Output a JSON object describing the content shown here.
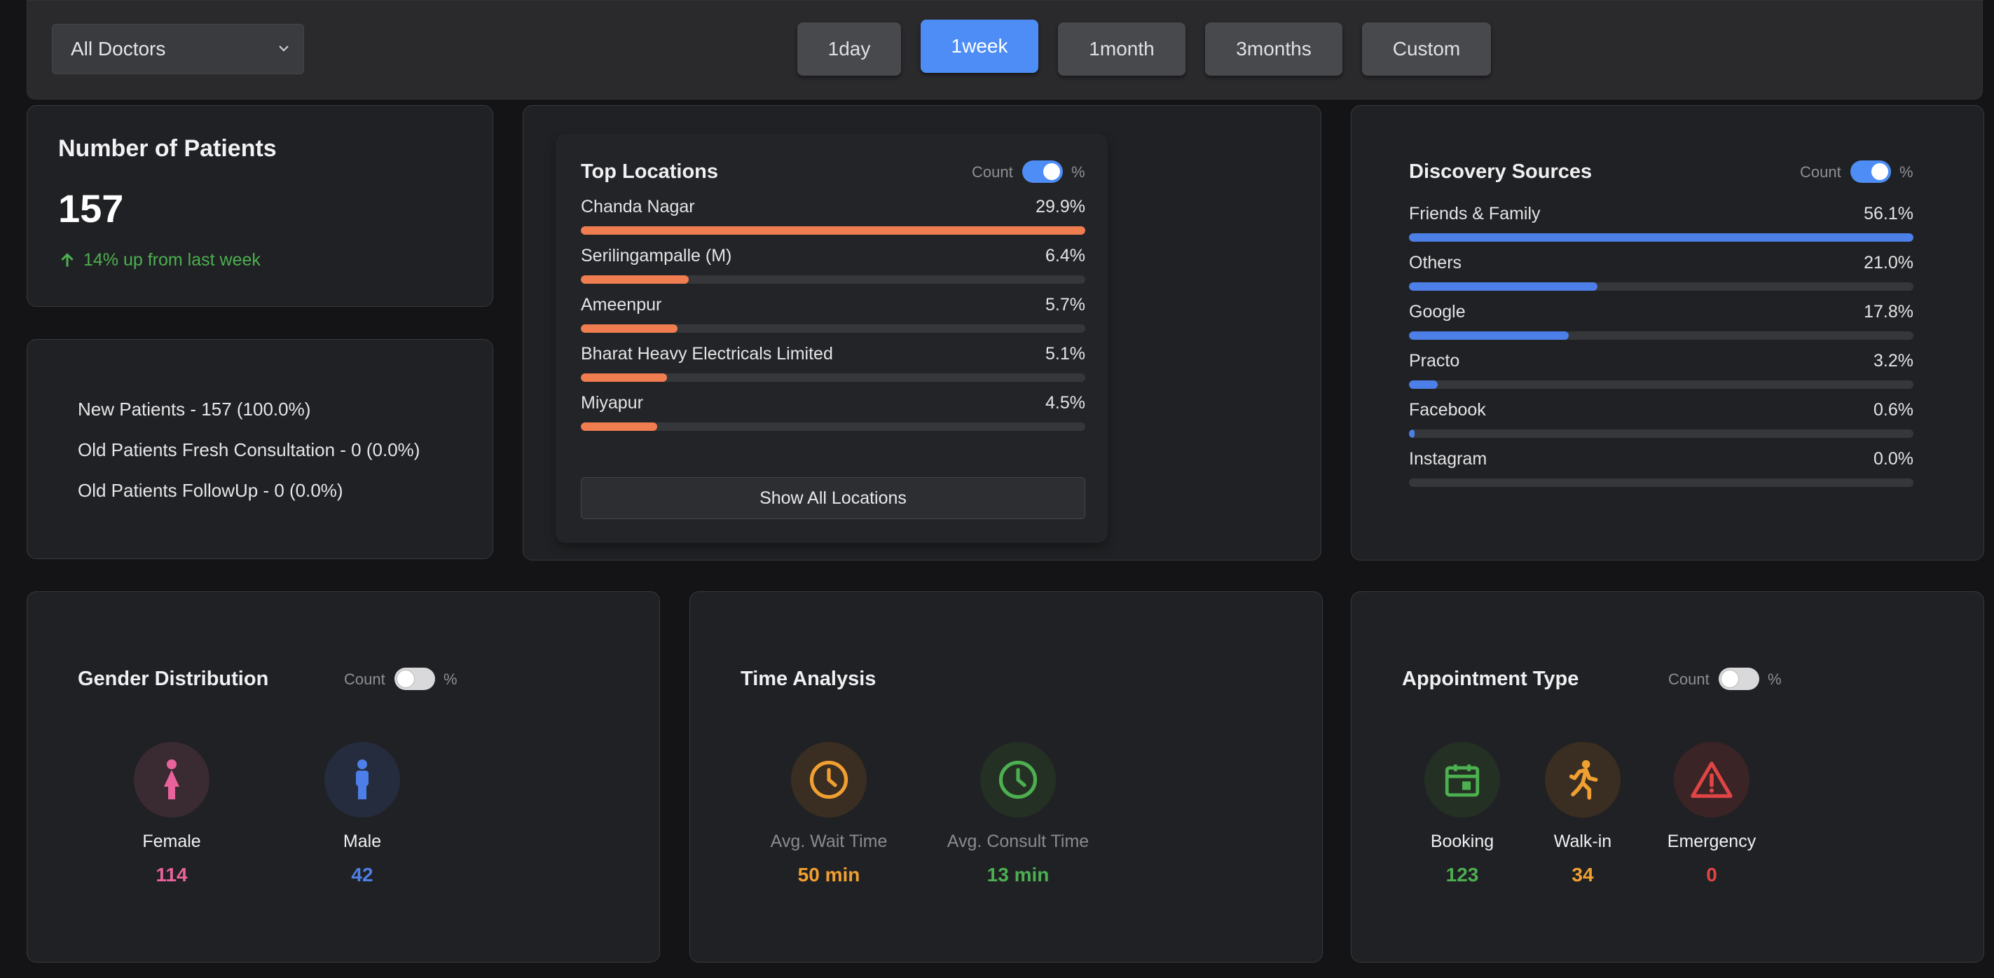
{
  "toolbar": {
    "doctor_select": "All Doctors",
    "ranges": [
      "1day",
      "1week",
      "1month",
      "3months",
      "Custom"
    ],
    "active_range": "1week"
  },
  "patients": {
    "title": "Number of Patients",
    "count": "157",
    "trend": "14% up from last week",
    "breakdown": [
      "New Patients - 157 (100.0%)",
      "Old Patients Fresh Consultation - 0 (0.0%)",
      "Old Patients FollowUp - 0 (0.0%)"
    ]
  },
  "locations": {
    "title": "Top Locations",
    "toggle_left": "Count",
    "toggle_right": "%",
    "toggle_on": true,
    "bar_color": "#f07d4f",
    "items": [
      {
        "label": "Chanda Nagar",
        "pct": "29.9%",
        "fill": 1.0
      },
      {
        "label": "Serilingampalle (M)",
        "pct": "6.4%",
        "fill": 0.214
      },
      {
        "label": "Ameenpur",
        "pct": "5.7%",
        "fill": 0.191
      },
      {
        "label": "Bharat Heavy Electricals Limited",
        "pct": "5.1%",
        "fill": 0.171
      },
      {
        "label": "Miyapur",
        "pct": "4.5%",
        "fill": 0.151
      }
    ],
    "show_all": "Show All Locations"
  },
  "discovery": {
    "title": "Discovery Sources",
    "toggle_left": "Count",
    "toggle_right": "%",
    "toggle_on": true,
    "bar_color": "#4d7fe8",
    "items": [
      {
        "label": "Friends & Family",
        "pct": "56.1%",
        "fill": 1.0
      },
      {
        "label": "Others",
        "pct": "21.0%",
        "fill": 0.374
      },
      {
        "label": "Google",
        "pct": "17.8%",
        "fill": 0.317
      },
      {
        "label": "Practo",
        "pct": "3.2%",
        "fill": 0.057
      },
      {
        "label": "Facebook",
        "pct": "0.6%",
        "fill": 0.011
      },
      {
        "label": "Instagram",
        "pct": "0.0%",
        "fill": 0.0
      }
    ]
  },
  "gender": {
    "title": "Gender Distribution",
    "toggle_left": "Count",
    "toggle_right": "%",
    "toggle_on": false,
    "female": {
      "label": "Female",
      "value": "114",
      "color": "#e8639b",
      "icon": "female-icon"
    },
    "male": {
      "label": "Male",
      "value": "42",
      "color": "#4d7fe8",
      "icon": "male-icon"
    }
  },
  "time": {
    "title": "Time Analysis",
    "wait": {
      "label": "Avg. Wait Time",
      "value": "50 min",
      "color": "#f0a030",
      "icon": "clock-icon"
    },
    "consult": {
      "label": "Avg. Consult Time",
      "value": "13 min",
      "color": "#4caf50",
      "icon": "clock-icon"
    }
  },
  "appointments": {
    "title": "Appointment Type",
    "toggle_left": "Count",
    "toggle_right": "%",
    "toggle_on": false,
    "booking": {
      "label": "Booking",
      "value": "123",
      "color": "#4caf50",
      "icon": "calendar-icon"
    },
    "walkin": {
      "label": "Walk-in",
      "value": "34",
      "color": "#f0a030",
      "icon": "walking-icon"
    },
    "emergency": {
      "label": "Emergency",
      "value": "0",
      "color": "#e04545",
      "icon": "warning-icon"
    }
  }
}
